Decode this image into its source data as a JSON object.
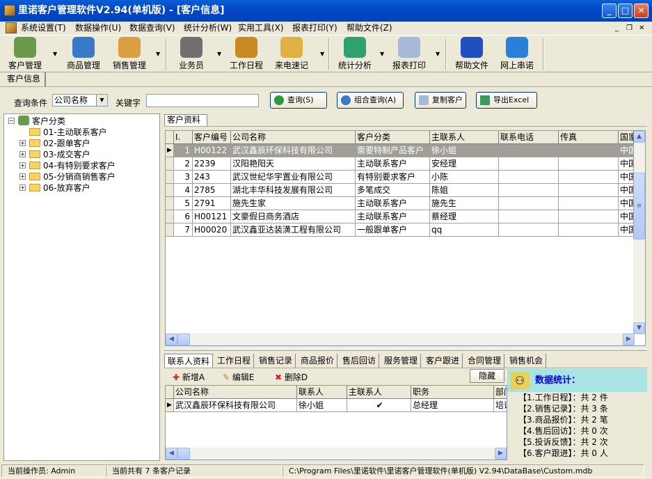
{
  "window": {
    "title": "里诺客户管理软件V2.94(单机版) - [客户信息]",
    "min": "_",
    "max": "□",
    "close": "✕"
  },
  "menu": [
    "系统设置(T)",
    "数据操作(U)",
    "数据查询(V)",
    "统计分析(W)",
    "实用工具(X)",
    "报表打印(Y)",
    "帮助文件(Z)"
  ],
  "toolbar": [
    {
      "label": "客户管理",
      "icon": "customer-icon",
      "color": "#6a9a4a"
    },
    {
      "label": "商品管理",
      "icon": "cabinet-icon",
      "color": "#3a78c8"
    },
    {
      "label": "销售管理",
      "icon": "box-icon",
      "color": "#d8a040"
    },
    {
      "label": "业务员",
      "icon": "people-icon",
      "color": "#707070"
    },
    {
      "label": "工作日程",
      "icon": "schedule-icon",
      "color": "#c88a20"
    },
    {
      "label": "来电速记",
      "icon": "notes-icon",
      "color": "#e0b040"
    },
    {
      "label": "统计分析",
      "icon": "piechart-icon",
      "color": "#30a070"
    },
    {
      "label": "报表打印",
      "icon": "report-icon",
      "color": "#a8b8d8"
    },
    {
      "label": "帮助文件",
      "icon": "help-icon",
      "color": "#2050c0"
    },
    {
      "label": "网上串诺",
      "icon": "ie-icon",
      "color": "#2a80d8"
    }
  ],
  "doc_tab": "客户信息",
  "search": {
    "condition_label": "查询条件",
    "condition_value": "公司名称",
    "keyword_label": "关键字",
    "keyword_value": "",
    "query": "查询(S)",
    "combo_query": "组合查询(A)",
    "copy": "复制客户",
    "export": "导出Excel"
  },
  "tree": {
    "root": "客户分类",
    "items": [
      "01-主动联系客户",
      "02-跟单客户",
      "03-成交客户",
      "04-有特别要求客户",
      "05-分销商销售客户",
      "06-放弃客户"
    ]
  },
  "grid": {
    "tab": "客户资料",
    "columns": [
      "I.",
      "客户编号",
      "公司名称",
      "客户分类",
      "主联系人",
      "联系电话",
      "传真",
      "国家"
    ],
    "rows": [
      [
        "1",
        "H00122",
        "武汉鑫辰环保科技有限公司",
        "需要特制产品客户",
        "徐小姐",
        "",
        "",
        "中国"
      ],
      [
        "2",
        "2239",
        "汉阳艳阳天",
        "主动联系客户",
        "安经理",
        "",
        "",
        "中国"
      ],
      [
        "3",
        "243",
        "武汉世纪华宇置业有限公司",
        "有特别要求客户",
        "小陈",
        "",
        "",
        "中国"
      ],
      [
        "4",
        "2785",
        "湖北丰华科技发展有限公司",
        "多笔成交",
        "陈姐",
        "",
        "",
        "中国"
      ],
      [
        "5",
        "2791",
        "施先生家",
        "主动联系客户",
        "施先生",
        "",
        "",
        "中国"
      ],
      [
        "6",
        "H00121",
        "文豪假日商务酒店",
        "主动联系客户",
        "蔡经理",
        "",
        "",
        "中国"
      ],
      [
        "7",
        "H00020",
        "武汉鑫亚达装潢工程有限公司",
        "一般跟单客户",
        "qq",
        "",
        "",
        "中国"
      ]
    ]
  },
  "bottom": {
    "tabs": [
      "联系人资料",
      "工作日程",
      "销售记录",
      "商品报价",
      "售后回访",
      "服务管理",
      "客户跟进",
      "合同管理",
      "销售机会"
    ],
    "add": "新增A",
    "edit": "编辑E",
    "delete": "删除D",
    "hide": "隐藏",
    "columns": [
      "公司名称",
      "联系人",
      "主联系人",
      "职务",
      "部门"
    ],
    "rows": [
      [
        "武汉鑫辰环保科技有限公司",
        "徐小姐",
        "✔",
        "总经理",
        "培训"
      ]
    ]
  },
  "stats": {
    "title": "数据统计：",
    "items": [
      "【1.工作日程】：共 2 件",
      "【2.销售记录】：共 3 条",
      "【3.商品报价】：共 2 笔",
      "【4.售后回访】：共 0 次",
      "【5.投诉反馈】：共 2 次",
      "【6.客户跟进】：共 0 人"
    ]
  },
  "status": {
    "operator": "当前操作员: Admin",
    "count": "当前共有 7 条客户记录",
    "path": "C:\\Program Files\\里诺软件\\里诺客户管理软件(单机版) V2.94\\DataBase\\Custom.mdb"
  }
}
